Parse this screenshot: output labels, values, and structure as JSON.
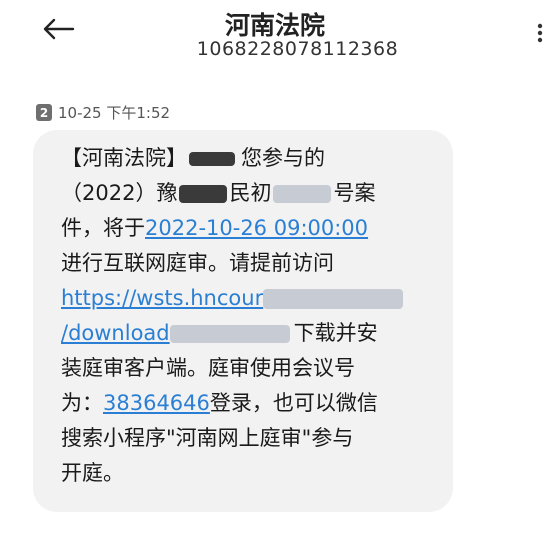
{
  "header": {
    "title": "河南法院",
    "number": "1068228078112368"
  },
  "message": {
    "sim": "2",
    "time": "10-25 下午1:52",
    "l1a": "【河南法院】",
    "l1b": "您参与的",
    "l2a": "（2022）豫",
    "l2b": "民初",
    "l2c": "号案",
    "l3a": "件，将于",
    "l3link": "2022-10-26 09:00:00",
    "l4": "进行互联网庭审。请提前访问",
    "l5link": "https://wsts.hncour",
    "l6link": "/download",
    "l6b": "下载并安",
    "l7": "装庭审客户端。庭审使用会议号",
    "l8a": "为：",
    "l8link": "38364646",
    "l8b": "登录，也可以微信",
    "l9": "搜索小程序\"河南网上庭审\"参与",
    "l10": "开庭。"
  },
  "icons": {
    "back": "back-arrow-icon",
    "more": "more-vertical-icon"
  }
}
